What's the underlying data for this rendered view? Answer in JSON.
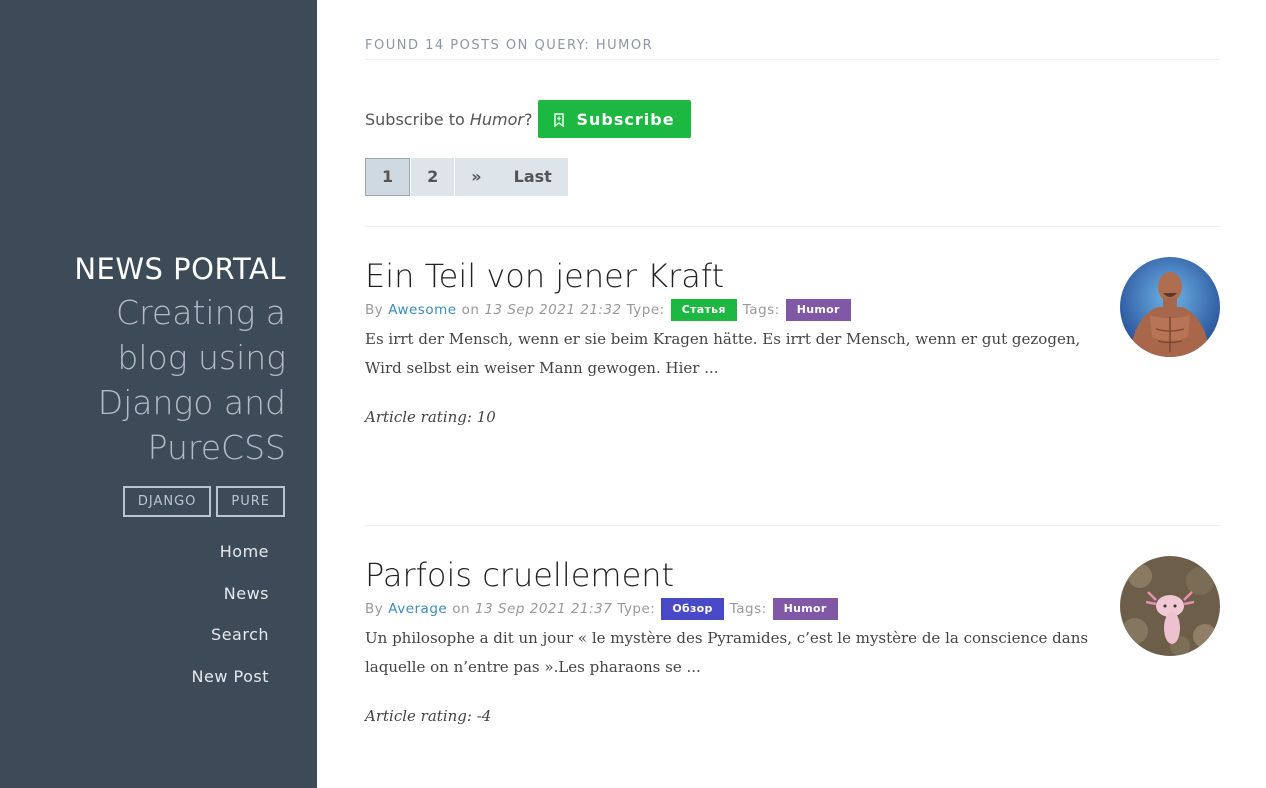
{
  "sidebar": {
    "brand_title": "NEWS PORTAL",
    "tagline": "Creating a blog using Django and PureCSS",
    "tags": [
      "DJANGO",
      "PURE"
    ],
    "nav": [
      "Home",
      "News",
      "Search",
      "New Post"
    ]
  },
  "query_header": "FOUND 14 POSTS ON QUERY: HUMOR",
  "subscribe": {
    "prefix": "Subscribe to",
    "topic": "Humor",
    "suffix": "?",
    "button_label": "Subscribe",
    "button_icon": "bookmark-icon",
    "button_color": "#1cb841"
  },
  "pagination": {
    "pages": [
      "1",
      "2"
    ],
    "next": "»",
    "last": "Last",
    "current": "1"
  },
  "posts": [
    {
      "title": "Ein Teil von jener Kraft",
      "by": "By",
      "author": "Awesome",
      "on": "on",
      "date": "13 Sep 2021 21:32",
      "type_label": "Type:",
      "type": "Статья",
      "type_color": "#1cb841",
      "tags_label": "Tags:",
      "tag": "Humor",
      "tag_color": "#8058a5",
      "excerpt": "Es irrt der Mensch, wenn er sie beim Kragen hätte. Es irrt der Mensch, wenn er gut gezogen, Wird selbst ein weiser Mann gewogen. Hier ...",
      "rating": "Article rating: 10",
      "avatar": "muscular-man-avatar"
    },
    {
      "title": "Parfois cruellement",
      "by": "By",
      "author": "Average",
      "on": "on",
      "date": "13 Sep 2021 21:37",
      "type_label": "Type:",
      "type": "Обзор",
      "type_color": "#4949c8",
      "tags_label": "Tags:",
      "tag": "Humor",
      "tag_color": "#8058a5",
      "excerpt": "Un philosophe a dit un jour « le mystère des Pyramides, c’est le mystère de la conscience dans laquelle on n’entre pas ».Les pharaons se ...",
      "rating": "Article rating: -4",
      "avatar": "axolotl-avatar"
    }
  ]
}
